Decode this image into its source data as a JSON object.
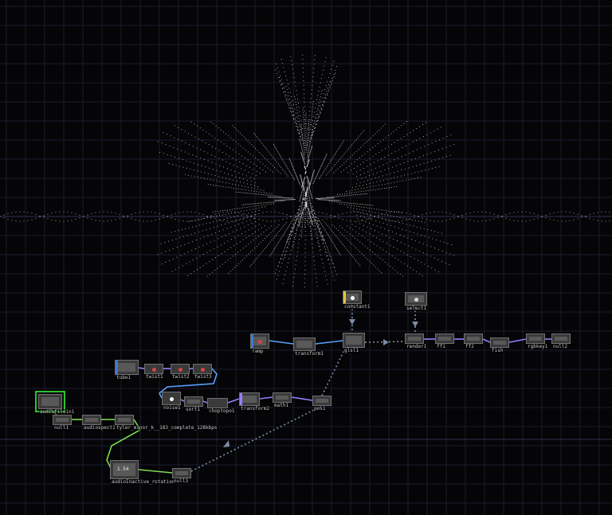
{
  "app": {
    "canvas": "network-editor"
  },
  "colors": {
    "background": "#050507",
    "grid": "#1b1c2e",
    "grid_major": "#2e3050",
    "wire_top": "#5aa0ff",
    "wire_sop": "#9a7cff",
    "wire_chop": "#7fdc4f",
    "wire_export": "#7d8ea8",
    "particles": "#e8e8e8",
    "selected": "#2fbf2f"
  },
  "nodes": {
    "constant1": "constant1",
    "select1": "select1",
    "ramp": "ramp",
    "transform1": "transform1",
    "glsl1": "glsl1",
    "render": "render1",
    "ff1": "ff1",
    "ff2": "ff2",
    "fish": "fish",
    "rgbkey": "rgbkey1",
    "null2": "null2",
    "tube": "tube1",
    "twist1": "twist1",
    "twist2": "twist2",
    "twist3": "twist3",
    "noise1": "noise1",
    "sort1": "sort1",
    "choptopo": "choptopo1",
    "transform2": "transform2",
    "math": "math1",
    "pos": "pos1",
    "audiofile": "audiofilein1",
    "audio_spect": "audiospect1",
    "audio_track": "tyler_minor_k__183_complete_128kbps",
    "null_a": "null1",
    "null_b": "null2",
    "rotation": "audioInactive_rotation",
    "rotation_val": "1.54",
    "null3": "null3"
  }
}
